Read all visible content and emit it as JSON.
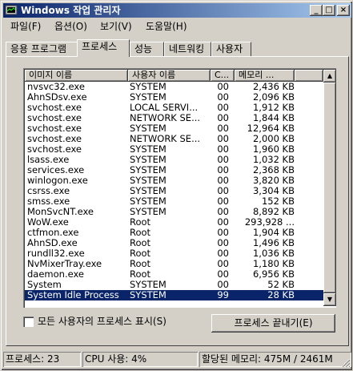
{
  "window": {
    "title": "Windows 작업 관리자"
  },
  "title_buttons": {
    "minimize": "_",
    "maximize": "□",
    "close": "×"
  },
  "menu": [
    {
      "label": "파일(F)"
    },
    {
      "label": "옵션(O)"
    },
    {
      "label": "보기(V)"
    },
    {
      "label": "도움말(H)"
    }
  ],
  "tabs": [
    {
      "label": "응용 프로그램"
    },
    {
      "label": "프로세스"
    },
    {
      "label": "성능"
    },
    {
      "label": "네트워킹"
    },
    {
      "label": "사용자"
    }
  ],
  "active_tab": "프로세스",
  "table": {
    "columns": [
      "이미지 이름",
      "사용자 이름",
      "C...",
      "메모리 ..."
    ],
    "rows": [
      {
        "image": "nvsvc32.exe",
        "user": "SYSTEM",
        "cpu": "00",
        "mem": "2,436 KB"
      },
      {
        "image": "AhnSDsv.exe",
        "user": "SYSTEM",
        "cpu": "00",
        "mem": "2,096 KB"
      },
      {
        "image": "svchost.exe",
        "user": "LOCAL SERVI...",
        "cpu": "00",
        "mem": "1,912 KB"
      },
      {
        "image": "svchost.exe",
        "user": "NETWORK SE...",
        "cpu": "00",
        "mem": "1,844 KB"
      },
      {
        "image": "svchost.exe",
        "user": "SYSTEM",
        "cpu": "00",
        "mem": "12,964 KB"
      },
      {
        "image": "svchost.exe",
        "user": "NETWORK SE...",
        "cpu": "00",
        "mem": "2,000 KB"
      },
      {
        "image": "svchost.exe",
        "user": "SYSTEM",
        "cpu": "00",
        "mem": "1,960 KB"
      },
      {
        "image": "lsass.exe",
        "user": "SYSTEM",
        "cpu": "00",
        "mem": "1,032 KB"
      },
      {
        "image": "services.exe",
        "user": "SYSTEM",
        "cpu": "00",
        "mem": "2,368 KB"
      },
      {
        "image": "winlogon.exe",
        "user": "SYSTEM",
        "cpu": "00",
        "mem": "3,820 KB"
      },
      {
        "image": "csrss.exe",
        "user": "SYSTEM",
        "cpu": "00",
        "mem": "3,304 KB"
      },
      {
        "image": "smss.exe",
        "user": "SYSTEM",
        "cpu": "00",
        "mem": "152 KB"
      },
      {
        "image": "MonSvcNT.exe",
        "user": "SYSTEM",
        "cpu": "00",
        "mem": "8,892 KB"
      },
      {
        "image": "WoW.exe",
        "user": "Root",
        "cpu": "00",
        "mem": "293,928 ..."
      },
      {
        "image": "ctfmon.exe",
        "user": "Root",
        "cpu": "00",
        "mem": "1,904 KB"
      },
      {
        "image": "AhnSD.exe",
        "user": "Root",
        "cpu": "00",
        "mem": "1,496 KB"
      },
      {
        "image": "rundll32.exe",
        "user": "Root",
        "cpu": "00",
        "mem": "1,036 KB"
      },
      {
        "image": "NvMixerTray.exe",
        "user": "Root",
        "cpu": "00",
        "mem": "1,180 KB"
      },
      {
        "image": "daemon.exe",
        "user": "Root",
        "cpu": "00",
        "mem": "6,956 KB"
      },
      {
        "image": "System",
        "user": "SYSTEM",
        "cpu": "00",
        "mem": "52 KB"
      },
      {
        "image": "System Idle Process",
        "user": "SYSTEM",
        "cpu": "99",
        "mem": "28 KB",
        "selected": true
      }
    ]
  },
  "scrollbar": {
    "up_arrow": "▲",
    "down_arrow": "▼"
  },
  "show_all_users": {
    "label": "모든 사용자의 프로세스 표시(S)",
    "checked": false
  },
  "end_process_button": "프로세스 끝내기(E)",
  "status": {
    "processes": "프로세스: 23",
    "cpu": "CPU 사용: 4%",
    "memory": "할당된 메모리: 475M / 2461M"
  },
  "colors": {
    "title_start": "#0a246a",
    "title_end": "#a6caf0",
    "selection": "#0a246a",
    "face": "#d4d0c8"
  }
}
